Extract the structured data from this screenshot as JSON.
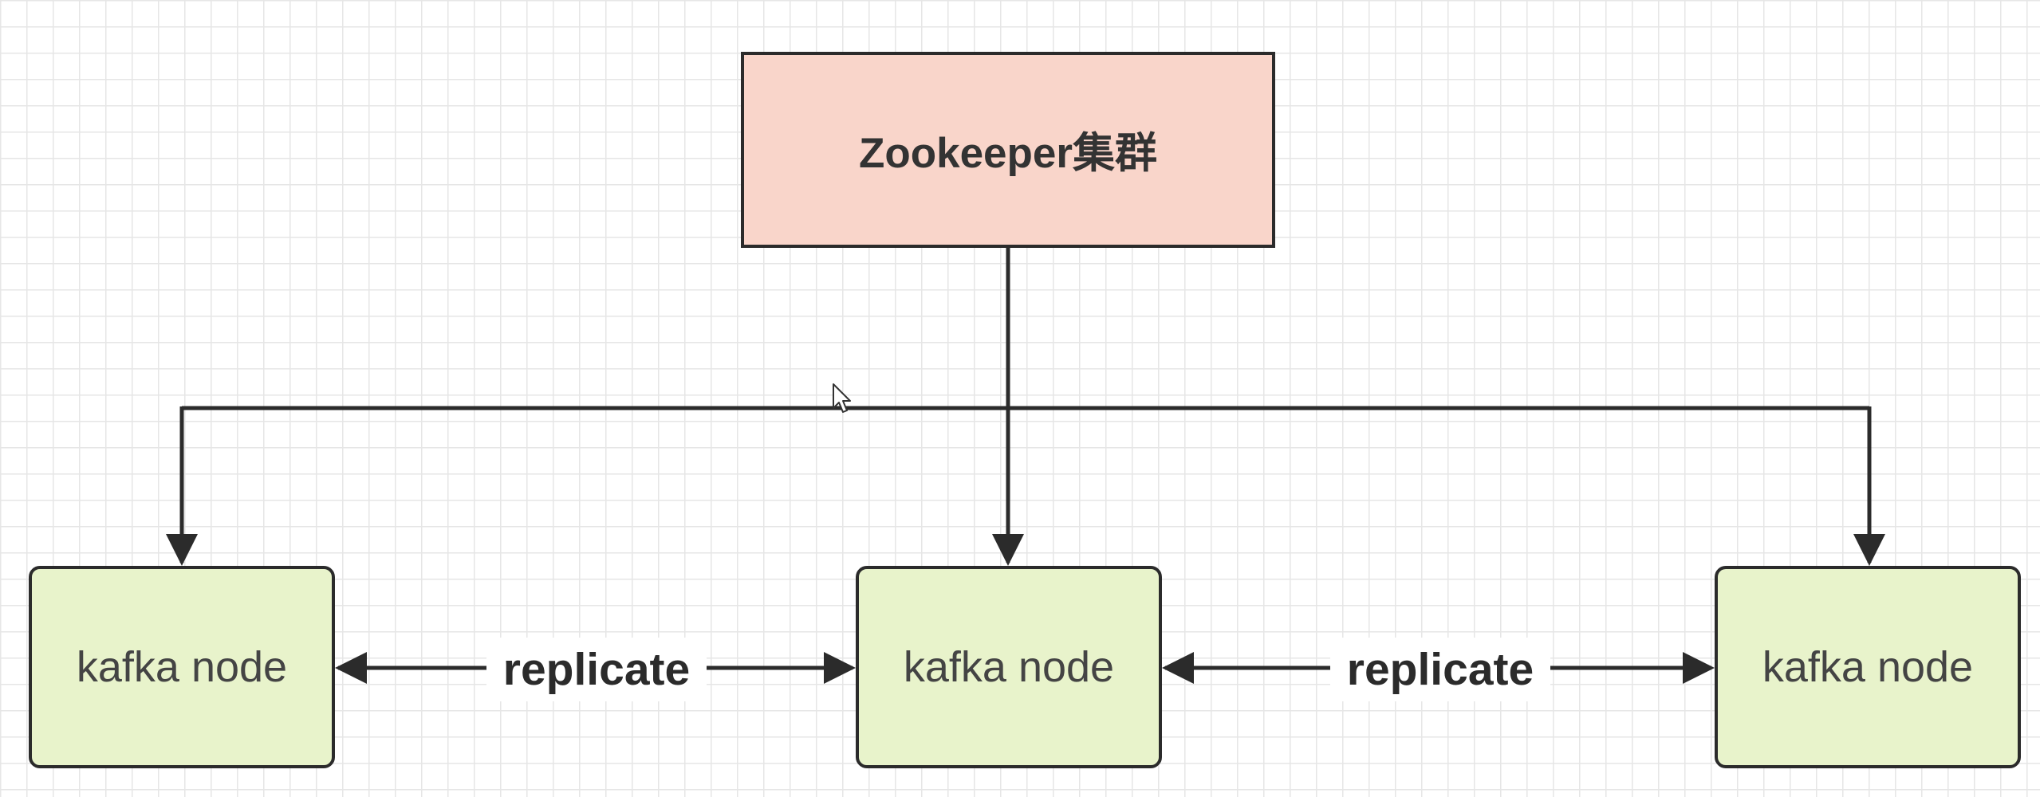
{
  "diagram": {
    "zookeeper": {
      "label": "Zookeeper集群",
      "fill": "#f9d5ca"
    },
    "nodes": [
      {
        "label": "kafka node",
        "fill": "#e8f3cb"
      },
      {
        "label": "kafka node",
        "fill": "#e8f3cb"
      },
      {
        "label": "kafka node",
        "fill": "#e8f3cb"
      }
    ],
    "edges": [
      {
        "from": "Zookeeper集群",
        "to": "kafka node 1",
        "label": ""
      },
      {
        "from": "Zookeeper集群",
        "to": "kafka node 2",
        "label": ""
      },
      {
        "from": "Zookeeper集群",
        "to": "kafka node 3",
        "label": ""
      },
      {
        "from": "kafka node 1",
        "to": "kafka node 2",
        "label": "replicate",
        "bidirectional": true
      },
      {
        "from": "kafka node 2",
        "to": "kafka node 3",
        "label": "replicate",
        "bidirectional": true
      }
    ],
    "line_color": "#2b2b2b"
  }
}
